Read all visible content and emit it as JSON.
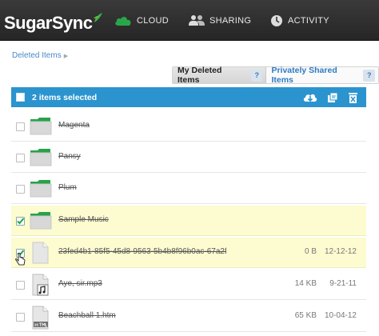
{
  "app": {
    "logo_text": "SugarSync"
  },
  "nav": [
    {
      "label": "CLOUD",
      "icon": "cloud-icon"
    },
    {
      "label": "SHARING",
      "icon": "people-icon"
    },
    {
      "label": "ACTIVITY",
      "icon": "clock-icon"
    }
  ],
  "breadcrumb": {
    "item": "Deleted Items"
  },
  "tabs": {
    "my_deleted": "My Deleted Items",
    "shared": "Privately Shared Items",
    "help": "?"
  },
  "selection_bar": {
    "text": "2 items selected",
    "actions": [
      "download-icon",
      "restore-icon",
      "delete-permanently-icon"
    ]
  },
  "files": [
    {
      "name": "Magenta",
      "type": "folder",
      "size": "",
      "date": "",
      "checked": false
    },
    {
      "name": "Pansy",
      "type": "folder",
      "size": "",
      "date": "",
      "checked": false
    },
    {
      "name": "Plum",
      "type": "folder",
      "size": "",
      "date": "",
      "checked": false
    },
    {
      "name": "Sample Music",
      "type": "folder",
      "size": "",
      "date": "",
      "checked": true
    },
    {
      "name": "23fed4b1-85f5-45d8-9563-5b4b8f96b0ac-67a2f-...",
      "type": "file",
      "size": "0 B",
      "date": "12-12-12",
      "checked": true
    },
    {
      "name": "Aye, sir.mp3",
      "type": "audio",
      "size": "14 KB",
      "date": "9-21-11",
      "checked": false
    },
    {
      "name": "Beachball 1.htm",
      "type": "html",
      "size": "65 KB",
      "date": "10-04-12",
      "checked": false
    }
  ],
  "colors": {
    "topbar": "#2f2f2f",
    "selection_bar": "#2b94cf",
    "selected_row": "#fdfbd0",
    "folder_tab": "#27a24a"
  }
}
